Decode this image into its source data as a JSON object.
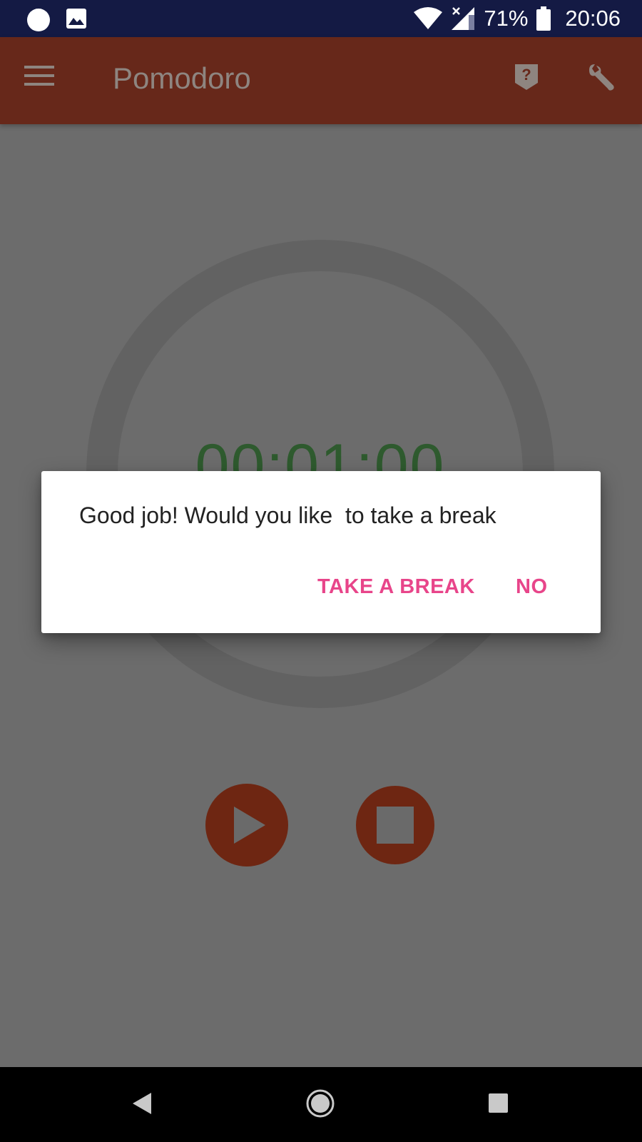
{
  "status_bar": {
    "battery_percent": "71%",
    "time": "20:06",
    "icons": [
      "tomato-notification-icon",
      "image-notification-icon",
      "wifi-icon",
      "cell-signal-icon",
      "battery-icon"
    ]
  },
  "app_bar": {
    "title": "Pomodoro",
    "color": "#67281a",
    "icons": [
      "menu-icon",
      "help-icon",
      "wrench-icon"
    ]
  },
  "timer": {
    "display": "00:01:00",
    "color": "#2e5a2e"
  },
  "controls": {
    "icons": [
      "play-icon",
      "stop-icon"
    ],
    "color": "#6e2612"
  },
  "dialog": {
    "message": "Good job! Would you like  to take a break",
    "take_break_label": "TAKE A BREAK",
    "no_label": "NO",
    "accent_color": "#e8458a"
  },
  "nav_bar": {
    "icons": [
      "back-icon",
      "home-icon",
      "recents-icon"
    ]
  }
}
